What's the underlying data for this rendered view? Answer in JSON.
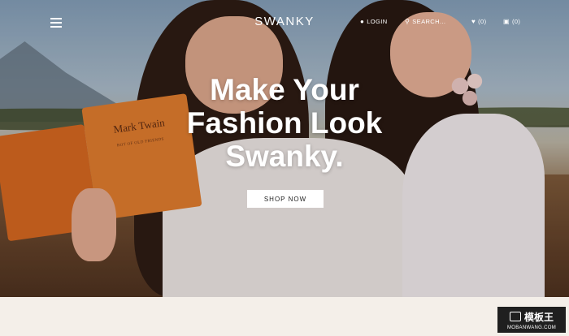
{
  "header": {
    "logo": "SWANKY",
    "login_label": "LOGIN",
    "search_placeholder": "SEARCH...",
    "wishlist_count": "(0)",
    "cart_count": "(0)"
  },
  "hero": {
    "headline": [
      "Make Your",
      "Fashion Look",
      "Swanky."
    ],
    "cta_label": "SHOP NOW",
    "book_title": "Mark Twain",
    "book_subtitle": "ROT OF OLD FRIENDS"
  },
  "watermark": {
    "top": "模板王",
    "bottom": "MOBANWANG.COM"
  }
}
